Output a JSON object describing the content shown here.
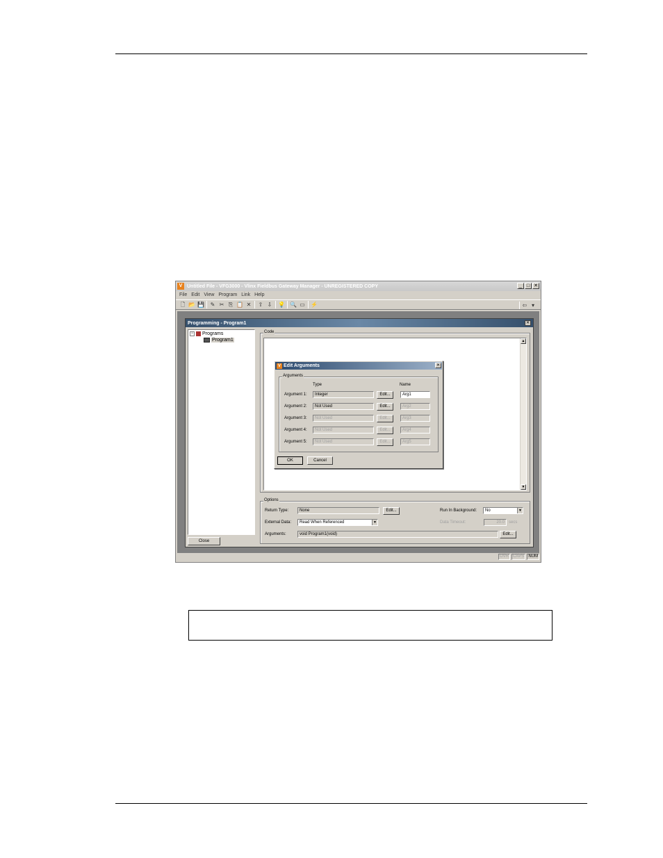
{
  "window": {
    "title": "Untitled File - VFG3000 - Vlinx Fieldbus Gateway Manager - UNREGISTERED COPY",
    "logo_text": "V",
    "minimize": "_",
    "maximize": "□",
    "close": "✕"
  },
  "menu": [
    "File",
    "Edit",
    "View",
    "Program",
    "Link",
    "Help"
  ],
  "toolbar": {
    "icons": [
      "new-icon",
      "open-icon",
      "save-icon",
      "pencil-icon",
      "cut-icon",
      "copy-icon",
      "paste-icon",
      "delete-icon",
      "up-icon",
      "down-icon",
      "bulb-icon",
      "find-icon",
      "window-icon",
      "flash-icon"
    ],
    "glyphs": [
      "🗋",
      "📂",
      "💾",
      "✎",
      "✂",
      "⎘",
      "📋",
      "✕",
      "⇧",
      "⇩",
      "💡",
      "🔍",
      "▭",
      "⚡"
    ],
    "right_glyph": "⇦",
    "right_arrow": "▾"
  },
  "mdi": {
    "title": "Programming - Program1",
    "close": "✕",
    "tree": {
      "root": "Programs",
      "child": "Program1",
      "expander": "−"
    },
    "close_button": "Close",
    "code_label": "Code",
    "scroll_up": "▲",
    "scroll_down": "▼",
    "options": {
      "label": "Options",
      "return_type_label": "Return Type:",
      "return_type_value": "None",
      "return_edit": "Edit...",
      "run_bg_label": "Run In Background:",
      "run_bg_value": "No",
      "external_label": "External Data:",
      "external_value": "Read When Referenced",
      "timeout_label": "Data Timeout:",
      "timeout_value": "20.0",
      "timeout_unit": "secs",
      "arguments_label": "Arguments:",
      "arguments_value": "void Program1(void)",
      "arguments_edit": "Edit...",
      "dropdown_arrow": "▼"
    }
  },
  "status": [
    "OVR",
    "CAPS",
    "NUM"
  ],
  "dialog": {
    "title": "Edit Arguments",
    "logo_text": "V",
    "close": "✕",
    "group_label": "Arguments",
    "type_header": "Type",
    "name_header": "Name",
    "rows": [
      {
        "label": "Argument 1:",
        "type": "Integer",
        "edit": "Edit...",
        "name": "Arg1"
      },
      {
        "label": "Argument 2:",
        "type": "Not Used",
        "edit": "Edit...",
        "name": "Arg2"
      },
      {
        "label": "Argument 3:",
        "type": "Not Used",
        "edit": "Edit...",
        "name": "Arg3"
      },
      {
        "label": "Argument 4:",
        "type": "Not Used",
        "edit": "Edit...",
        "name": "Arg4"
      },
      {
        "label": "Argument 5:",
        "type": "Not Used",
        "edit": "Edit...",
        "name": "Arg5"
      }
    ],
    "ok": "OK",
    "cancel": "Cancel"
  }
}
